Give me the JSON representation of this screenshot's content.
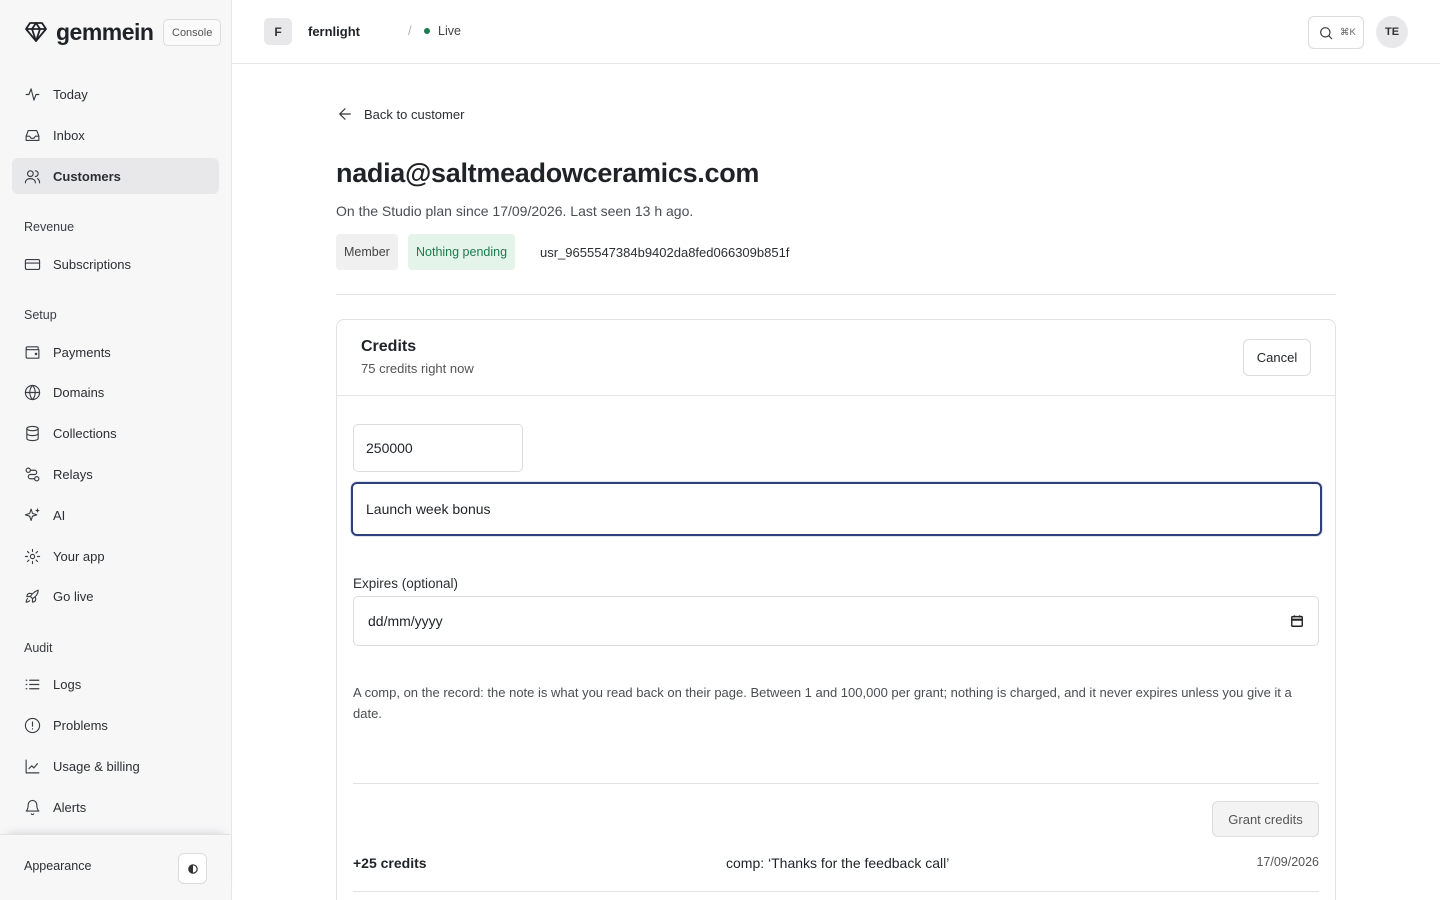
{
  "brand": {
    "name": "gemmein",
    "badge": "Console"
  },
  "sidebar": {
    "items": [
      {
        "label": "Today",
        "icon": "activity-icon"
      },
      {
        "label": "Inbox",
        "icon": "inbox-icon"
      },
      {
        "label": "Customers",
        "icon": "users-icon",
        "active": true
      }
    ],
    "sections": [
      {
        "title": "Revenue",
        "items": [
          {
            "label": "Subscriptions",
            "icon": "credit-card-icon"
          }
        ]
      },
      {
        "title": "Setup",
        "items": [
          {
            "label": "Payments",
            "icon": "wallet-icon"
          },
          {
            "label": "Domains",
            "icon": "globe-icon"
          },
          {
            "label": "Collections",
            "icon": "database-icon"
          },
          {
            "label": "Relays",
            "icon": "route-icon"
          },
          {
            "label": "AI",
            "icon": "sparkles-icon"
          },
          {
            "label": "Your app",
            "icon": "gear-icon"
          },
          {
            "label": "Go live",
            "icon": "rocket-icon"
          }
        ]
      },
      {
        "title": "Audit",
        "items": [
          {
            "label": "Logs",
            "icon": "list-icon"
          },
          {
            "label": "Problems",
            "icon": "alert-circle-icon"
          },
          {
            "label": "Usage & billing",
            "icon": "chart-icon"
          },
          {
            "label": "Alerts",
            "icon": "bell-icon"
          }
        ]
      }
    ],
    "footer": {
      "appearance_label": "Appearance"
    }
  },
  "topbar": {
    "org_initial": "F",
    "org_name": "fernlight",
    "separator": "/",
    "env_label": "Live",
    "env_color": "#1f7a4d",
    "search_shortcut": "⌘K",
    "user_initials": "TE"
  },
  "customer": {
    "back_label": "Back to customer",
    "email": "nadia@saltmeadowceramics.com",
    "summary": "On the Studio plan since 17/09/2026. Last seen 13 h ago.",
    "role_badge": "Member",
    "status_badge": "Nothing pending",
    "user_id": "usr_9655547384b9402da8fed066309b851f"
  },
  "credits": {
    "title": "Credits",
    "balance_text": "75 credits right now",
    "cancel_label": "Cancel",
    "amount_value": "250000",
    "note_value": "Launch week bonus",
    "expires_label": "Expires (optional)",
    "date_placeholder": "dd/mm/yyyy",
    "help_text": "A comp, on the record: the note is what you read back on their page. Between 1 and 100,000 per grant; nothing is charged, and it never expires unless you give it a date.",
    "grant_label": "Grant credits",
    "ledger": [
      {
        "amount": "+25 credits",
        "note": "comp: ‘Thanks for the feedback call’",
        "date": "17/09/2026"
      }
    ]
  }
}
